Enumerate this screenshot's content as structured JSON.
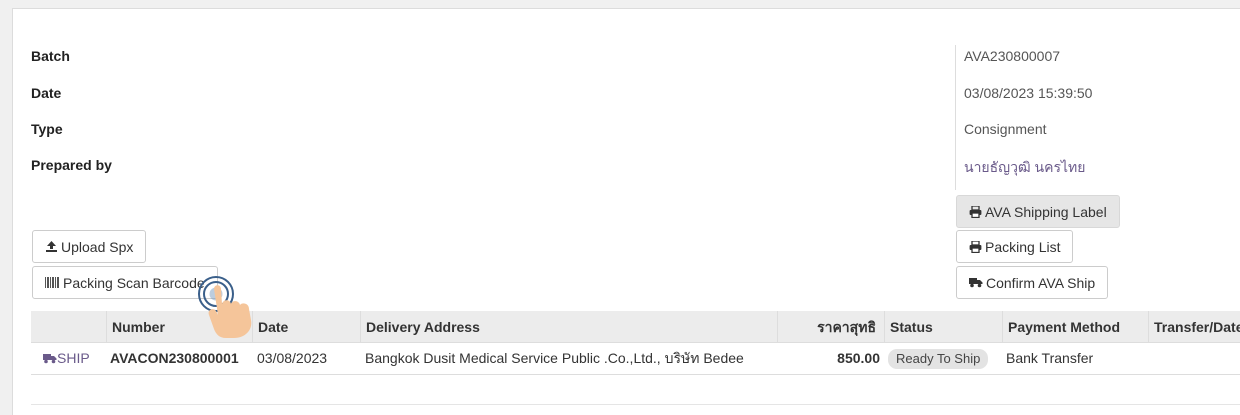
{
  "info": {
    "batch_label": "Batch",
    "date_label": "Date",
    "type_label": "Type",
    "prepared_label": "Prepared by",
    "batch_value": "AVA230800007",
    "date_value": "03/08/2023 15:39:50",
    "type_value": "Consignment",
    "prepared_value": "นายธัญวุฒิ นครไทย"
  },
  "buttons": {
    "upload_spx": "Upload Spx",
    "packing_scan": "Packing Scan Barcode",
    "ava_shipping_label": "AVA Shipping Label",
    "packing_list": "Packing List",
    "confirm_ava_ship": "Confirm AVA Ship"
  },
  "table": {
    "headers": [
      "",
      "Number",
      "Date",
      "Delivery Address",
      "ราคาสุทธิ",
      "Status",
      "Payment Method",
      "Transfer/Date"
    ],
    "rows": [
      {
        "action": "SHIP",
        "number": "AVACON230800001",
        "date": "03/08/2023",
        "address": "Bangkok Dusit Medical Service Public .Co.,Ltd., บริษัท Bedee",
        "net_price": "850.00",
        "status": "Ready To Ship",
        "payment": "Bank Transfer",
        "transfer_date": ""
      }
    ]
  },
  "icons": {
    "upload": "upload-icon",
    "barcode": "barcode-icon",
    "printer": "printer-icon",
    "truck": "truck-icon",
    "cursor": "pointer-hand-icon"
  },
  "colors": {
    "link": "#6a5a8a",
    "header_bg": "#ececec",
    "grey_button": "#e6e6e6",
    "hand": "#f5c59a"
  }
}
